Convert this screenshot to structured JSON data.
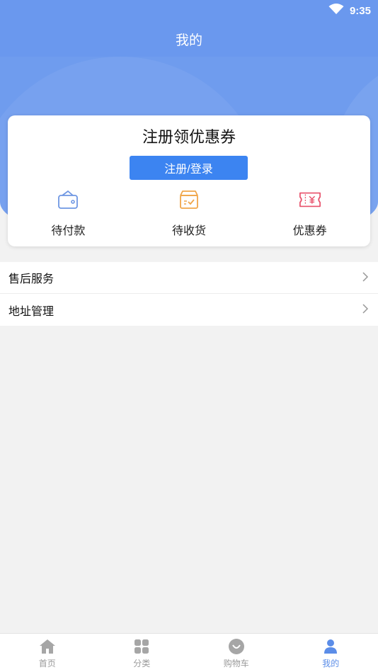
{
  "status_bar": {
    "time": "9:35"
  },
  "header": {
    "title": "我的"
  },
  "card": {
    "title": "注册领优惠券",
    "login_button": "注册/登录",
    "shortcuts": [
      {
        "label": "待付款",
        "icon": "wallet-icon",
        "color": "#6f97e3"
      },
      {
        "label": "待收货",
        "icon": "package-icon",
        "color": "#f0a64a"
      },
      {
        "label": "优惠券",
        "icon": "coupon-icon",
        "color": "#e8506a"
      }
    ]
  },
  "menu": {
    "items": [
      {
        "label": "售后服务"
      },
      {
        "label": "地址管理"
      }
    ]
  },
  "tabbar": {
    "items": [
      {
        "label": "首页",
        "icon": "home-icon",
        "active": false
      },
      {
        "label": "分类",
        "icon": "grid-icon",
        "active": false
      },
      {
        "label": "购物车",
        "icon": "cart-icon",
        "active": false
      },
      {
        "label": "我的",
        "icon": "user-icon",
        "active": true
      }
    ]
  },
  "colors": {
    "header_blue": "#6a98ee",
    "button_blue": "#3c84f1",
    "active_tab": "#5b8de8",
    "inactive_tab": "#9a9a9a"
  }
}
